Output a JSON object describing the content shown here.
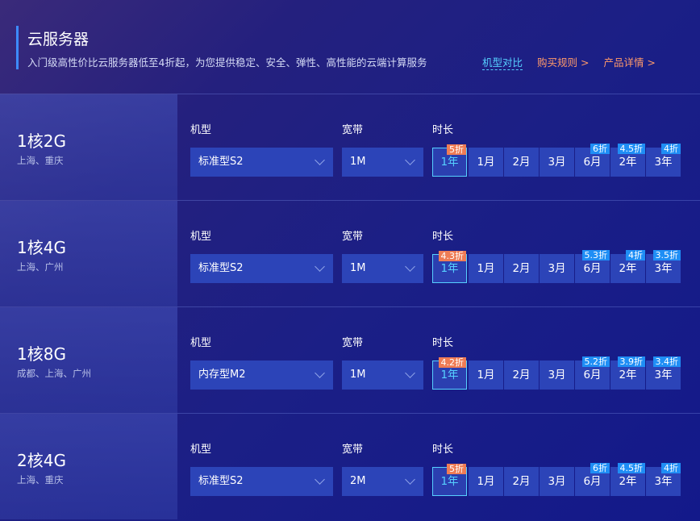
{
  "header": {
    "title": "云服务器",
    "description": "入门级高性价比云服务器低至4折起，为您提供稳定、安全、弹性、高性能的云端计算服务",
    "compare_link": "机型对比",
    "rules_link": "购买规则 >",
    "details_link": "产品详情 >"
  },
  "labels": {
    "model": "机型",
    "bandwidth": "宽带",
    "duration": "时长"
  },
  "durations": [
    "1年",
    "1月",
    "2月",
    "3月",
    "6月",
    "2年",
    "3年"
  ],
  "products": [
    {
      "config": "1核2G",
      "regions": "上海、重庆",
      "model": "标准型S2",
      "bandwidth": "1M",
      "selected_duration": "1年",
      "badges": {
        "1年": "5折",
        "6月": "6折",
        "2年": "4.5折",
        "3年": "4折"
      }
    },
    {
      "config": "1核4G",
      "regions": "上海、广州",
      "model": "标准型S2",
      "bandwidth": "1M",
      "selected_duration": "1年",
      "badges": {
        "1年": "4.3折",
        "6月": "5.3折",
        "2年": "4折",
        "3年": "3.5折"
      }
    },
    {
      "config": "1核8G",
      "regions": "成都、上海、广州",
      "model": "内存型M2",
      "bandwidth": "1M",
      "selected_duration": "1年",
      "badges": {
        "1年": "4.2折",
        "6月": "5.2折",
        "2年": "3.9折",
        "3年": "3.4折"
      }
    },
    {
      "config": "2核4G",
      "regions": "上海、重庆",
      "model": "标准型S2",
      "bandwidth": "2M",
      "selected_duration": "1年",
      "badges": {
        "1年": "5折",
        "6月": "6折",
        "2年": "4.5折",
        "3年": "4折"
      }
    }
  ],
  "colors": {
    "accent": "#56d0ff",
    "orange": "#ef7c55",
    "blue_badge": "#1f8ef5",
    "control_bg": "#2c44b8"
  }
}
